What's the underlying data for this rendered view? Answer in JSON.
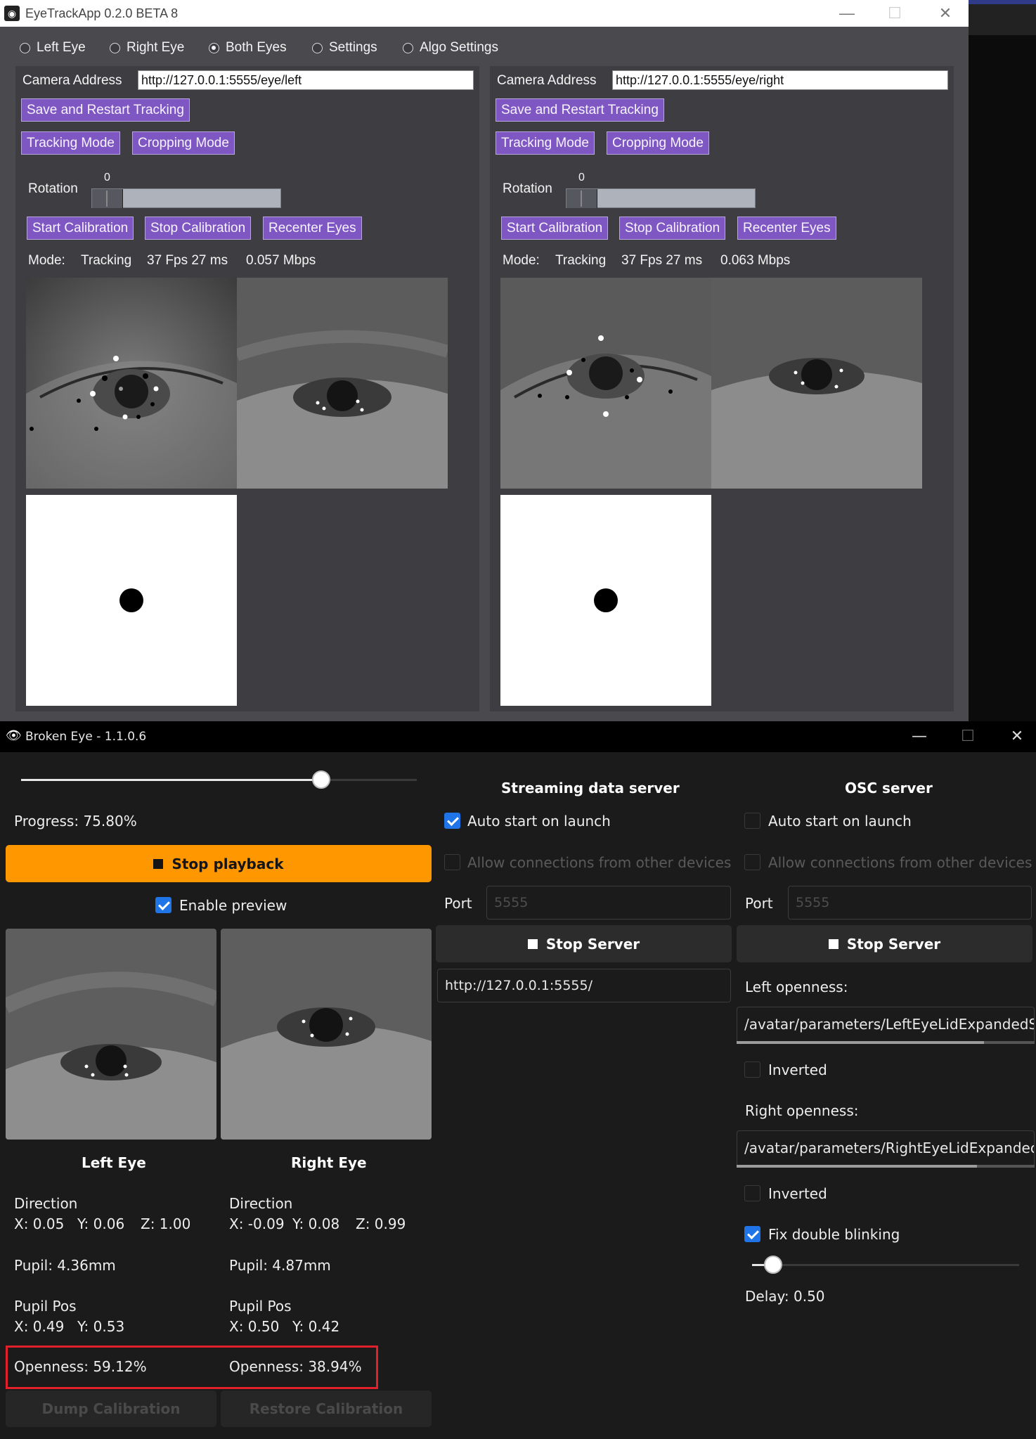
{
  "eyetrack": {
    "title": "EyeTrackApp 0.2.0 BETA 8",
    "app_icon": "eye-icon",
    "window_controls": [
      "—",
      "☐",
      "✕"
    ],
    "tabs": [
      "Left Eye",
      "Right Eye",
      "Both Eyes",
      "Settings",
      "Algo Settings"
    ],
    "selected_tab": "Both Eyes",
    "left": {
      "camera_label": "Camera Address",
      "camera_value": "http://127.0.0.1:5555/eye/left",
      "save_restart": "Save and Restart Tracking",
      "tracking_mode": "Tracking Mode",
      "cropping_mode": "Cropping Mode",
      "rotation_label": "Rotation",
      "rotation_value": "0",
      "start_cal": "Start Calibration",
      "stop_cal": "Stop Calibration",
      "recenter": "Recenter Eyes",
      "mode_label": "Mode:",
      "mode_value": "Tracking",
      "fps": "37 Fps 27 ms",
      "mbps": "0.057 Mbps"
    },
    "right": {
      "camera_label": "Camera Address",
      "camera_value": "http://127.0.0.1:5555/eye/right",
      "save_restart": "Save and Restart Tracking",
      "tracking_mode": "Tracking Mode",
      "cropping_mode": "Cropping Mode",
      "rotation_label": "Rotation",
      "rotation_value": "0",
      "start_cal": "Start Calibration",
      "stop_cal": "Stop Calibration",
      "recenter": "Recenter Eyes",
      "mode_label": "Mode:",
      "mode_value": "Tracking",
      "fps": "37 Fps 27 ms",
      "mbps": "0.063 Mbps"
    }
  },
  "brokeneye": {
    "title": "Broken Eye - 1.1.0.6",
    "app_icon": "eye-icon",
    "window_controls": [
      "—",
      "☐",
      "✕"
    ],
    "playback": {
      "progress_text": "Progress: 75.80%",
      "progress_value": 0.758,
      "stop_label": "Stop playback",
      "enable_preview": "Enable preview",
      "enable_preview_checked": true
    },
    "left_eye": {
      "heading": "Left Eye",
      "direction_label": "Direction",
      "dir_x": "X: 0.05",
      "dir_y": "Y: 0.06",
      "dir_z": "Z: 1.00",
      "pupil": "Pupil: 4.36mm",
      "pupilpos_label": "Pupil Pos",
      "pos_x": "X: 0.49",
      "pos_y": "Y: 0.53",
      "openness": "Openness: 59.12%"
    },
    "right_eye": {
      "heading": "Right Eye",
      "direction_label": "Direction",
      "dir_x": "X: -0.09",
      "dir_y": "Y: 0.08",
      "dir_z": "Z: 0.99",
      "pupil": "Pupil: 4.87mm",
      "pupilpos_label": "Pupil Pos",
      "pos_x": "X: 0.50",
      "pos_y": "Y: 0.42",
      "openness": "Openness: 38.94%"
    },
    "dump_calibration": "Dump Calibration",
    "restore_calibration": "Restore Calibration",
    "streaming": {
      "title": "Streaming data server",
      "auto_start": "Auto start on launch",
      "auto_start_checked": true,
      "allow": "Allow connections from other devices",
      "port_label": "Port",
      "port_placeholder": "5555",
      "stop_server": "Stop Server",
      "url": "http://127.0.0.1:5555/"
    },
    "osc": {
      "title": "OSC server",
      "auto_start": "Auto start on launch",
      "auto_start_checked": false,
      "allow": "Allow connections from other devices",
      "port_label": "Port",
      "port_placeholder": "5555",
      "stop_server": "Stop Server",
      "left_openness_label": "Left openness:",
      "left_openness_value": "/avatar/parameters/LeftEyeLidExpandedS",
      "inverted": "Inverted",
      "right_openness_label": "Right openness:",
      "right_openness_value": "/avatar/parameters/RightEyeLidExpandec",
      "fix_double_blinking": "Fix double blinking",
      "fix_checked": true,
      "delay_text": "Delay: 0.50",
      "delay_value": 0.5
    },
    "highlight_color": "#e0202a",
    "accent_color": "#ff9800"
  }
}
